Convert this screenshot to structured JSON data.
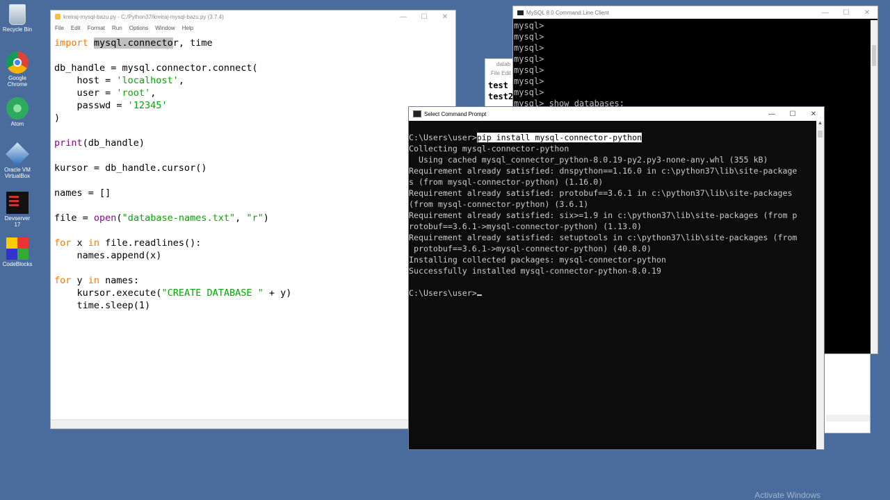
{
  "desktop": {
    "icons": [
      {
        "label": "Recycle Bin",
        "icon": "recycle-bin-icon"
      },
      {
        "label": "Google Chrome",
        "icon": "chrome-icon"
      },
      {
        "label": "Atom",
        "icon": "atom-icon"
      },
      {
        "label": "Oracle VM VirtualBox",
        "icon": "virtualbox-icon"
      },
      {
        "label": "Devserver 17",
        "icon": "devserver-icon"
      },
      {
        "label": "CodeBlocks",
        "icon": "codeblocks-icon"
      }
    ],
    "watermark": "Activate Windows"
  },
  "idle": {
    "title": "kreiraj-mysql-bazu.py - C:/Python37/kreiraj-mysql-bazu.py (3.7.4)",
    "menu": [
      "File",
      "Edit",
      "Format",
      "Run",
      "Options",
      "Window",
      "Help"
    ],
    "code": {
      "l1_kw": "import",
      "l1_sel": "mysql.connecto",
      "l1_rest": "r, time",
      "l3": "db_handle = mysql.connector.connect(",
      "l4_a": "    host = ",
      "l4_s": "'localhost'",
      "l5_a": "    user = ",
      "l5_s": "'root'",
      "l6_a": "    passwd = ",
      "l6_s": "'12345'",
      "l7": ")",
      "l9_bi": "print",
      "l9_rest": "(db_handle)",
      "l11": "kursor = db_handle.cursor()",
      "l13": "names = []",
      "l15_a": "file = ",
      "l15_bi": "open",
      "l15_b": "(",
      "l15_s1": "\"database-names.txt\"",
      "l15_c": ", ",
      "l15_s2": "\"r\"",
      "l15_d": ")",
      "l17_kw1": "for",
      "l17_a": " x ",
      "l17_kw2": "in",
      "l17_b": " file.readlines():",
      "l18": "    names.append(x)",
      "l20_kw1": "for",
      "l20_a": " y ",
      "l20_kw2": "in",
      "l20_b": " names:",
      "l21_a": "    kursor.execute(",
      "l21_s": "\"CREATE DATABASE \"",
      "l21_b": " + y)",
      "l22": "    time.sleep(1)"
    }
  },
  "mysql": {
    "title": "MySQL 8.0 Command Line Client",
    "lines": [
      "mysql>",
      "mysql>",
      "mysql>",
      "mysql>",
      "mysql>",
      "mysql>",
      "mysql>",
      "mysql> show databases;"
    ]
  },
  "notepad": {
    "title": "datab",
    "menu": "File  Edit",
    "lines": [
      "test",
      "test2"
    ]
  },
  "cmd": {
    "title": "Select Command Prompt",
    "prompt": "C:\\Users\\user>",
    "command": "pip install mysql-connector-python",
    "output": [
      "Collecting mysql-connector-python",
      "  Using cached mysql_connector_python-8.0.19-py2.py3-none-any.whl (355 kB)",
      "Requirement already satisfied: dnspython==1.16.0 in c:\\python37\\lib\\site-package",
      "s (from mysql-connector-python) (1.16.0)",
      "Requirement already satisfied: protobuf==3.6.1 in c:\\python37\\lib\\site-packages",
      "(from mysql-connector-python) (3.6.1)",
      "Requirement already satisfied: six>=1.9 in c:\\python37\\lib\\site-packages (from p",
      "rotobuf==3.6.1->mysql-connector-python) (1.13.0)",
      "Requirement already satisfied: setuptools in c:\\python37\\lib\\site-packages (from",
      " protobuf==3.6.1->mysql-connector-python) (40.8.0)",
      "Installing collected packages: mysql-connector-python",
      "Successfully installed mysql-connector-python-8.0.19"
    ],
    "prompt2": "C:\\Users\\user>"
  },
  "window_controls": {
    "minimize": "—",
    "maximize": "☐",
    "close": "✕"
  }
}
